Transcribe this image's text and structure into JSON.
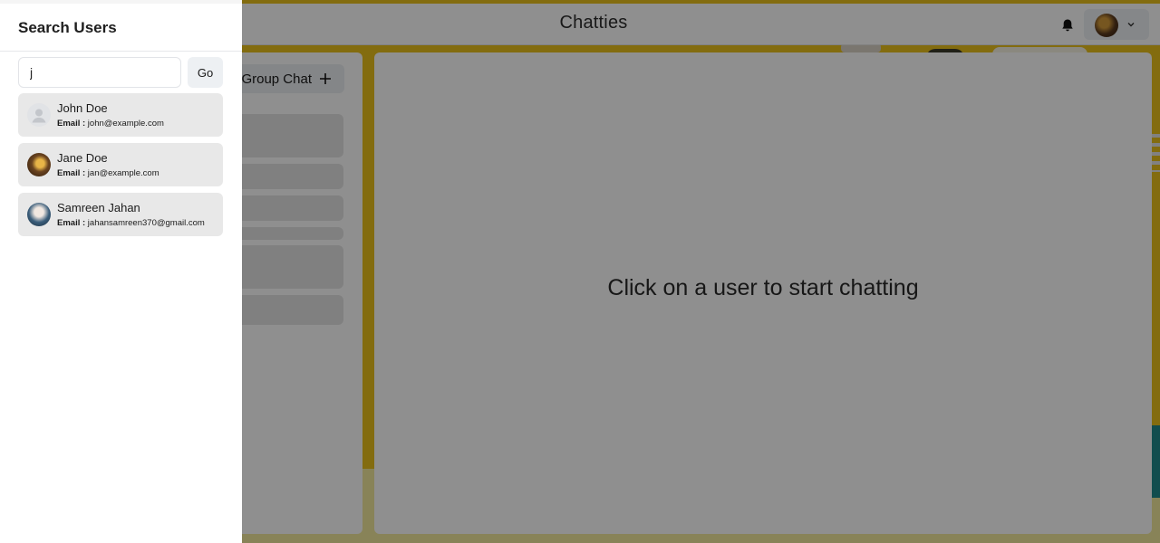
{
  "app": {
    "title": "Chatties"
  },
  "header": {
    "bell_icon": "bell-icon",
    "profile_icon": "chevron-down-icon"
  },
  "left_panel": {
    "group_chat_label": "Group Chat",
    "group_chat_icon": "plus-icon"
  },
  "main": {
    "empty_message": "Click on a user to start chatting"
  },
  "drawer": {
    "title": "Search Users",
    "search_value": "j",
    "go_label": "Go",
    "email_label": "Email :",
    "results": [
      {
        "name": "John Doe",
        "email": "john@example.com"
      },
      {
        "name": "Jane Doe",
        "email": "jan@example.com"
      },
      {
        "name": "Samreen Jahan",
        "email": "jahansamreen370@gmail.com"
      }
    ]
  },
  "colors": {
    "overlay": "#000000",
    "background_accent": "#e9c01c",
    "result_item_bg": "#e8e8e8"
  }
}
